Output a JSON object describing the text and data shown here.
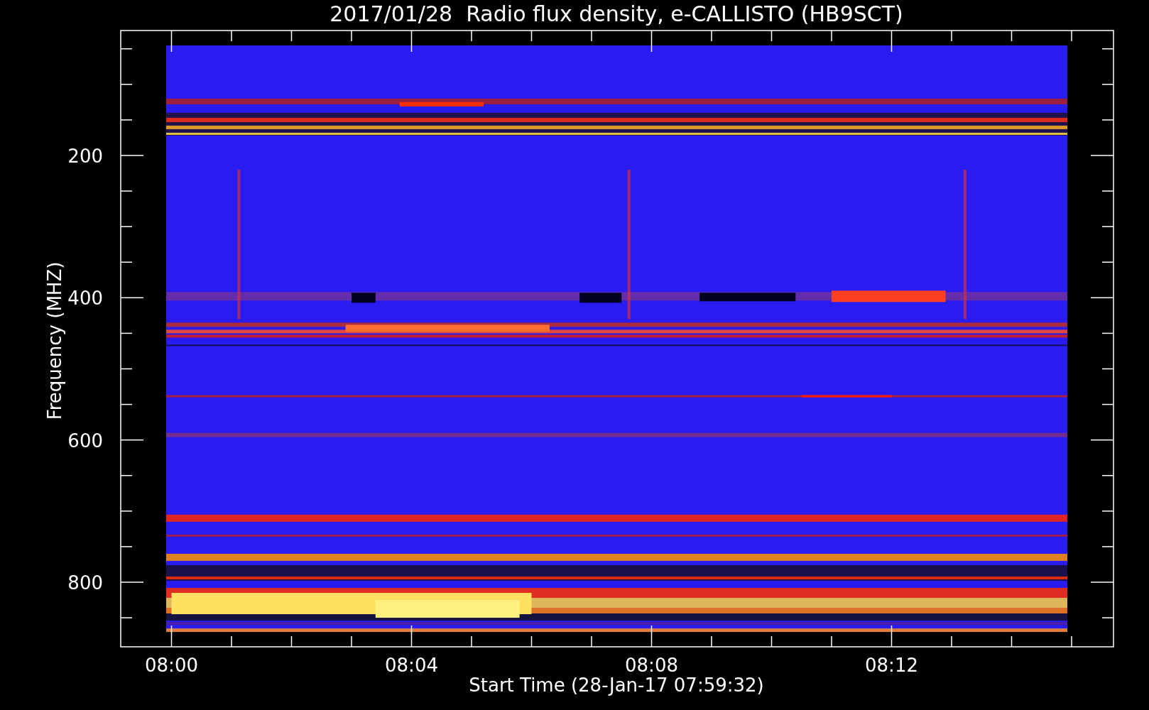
{
  "title": "2017/01/28  Radio flux density, e-CALLISTO (HB9SCT)",
  "y_axis": {
    "label": "Frequency (MHZ)",
    "ticks": [
      "200",
      "400",
      "600",
      "800"
    ]
  },
  "x_axis": {
    "label": "Start Time (28-Jan-17 07:59:32)",
    "ticks": [
      "08:00",
      "08:04",
      "08:08",
      "08:12"
    ]
  }
}
